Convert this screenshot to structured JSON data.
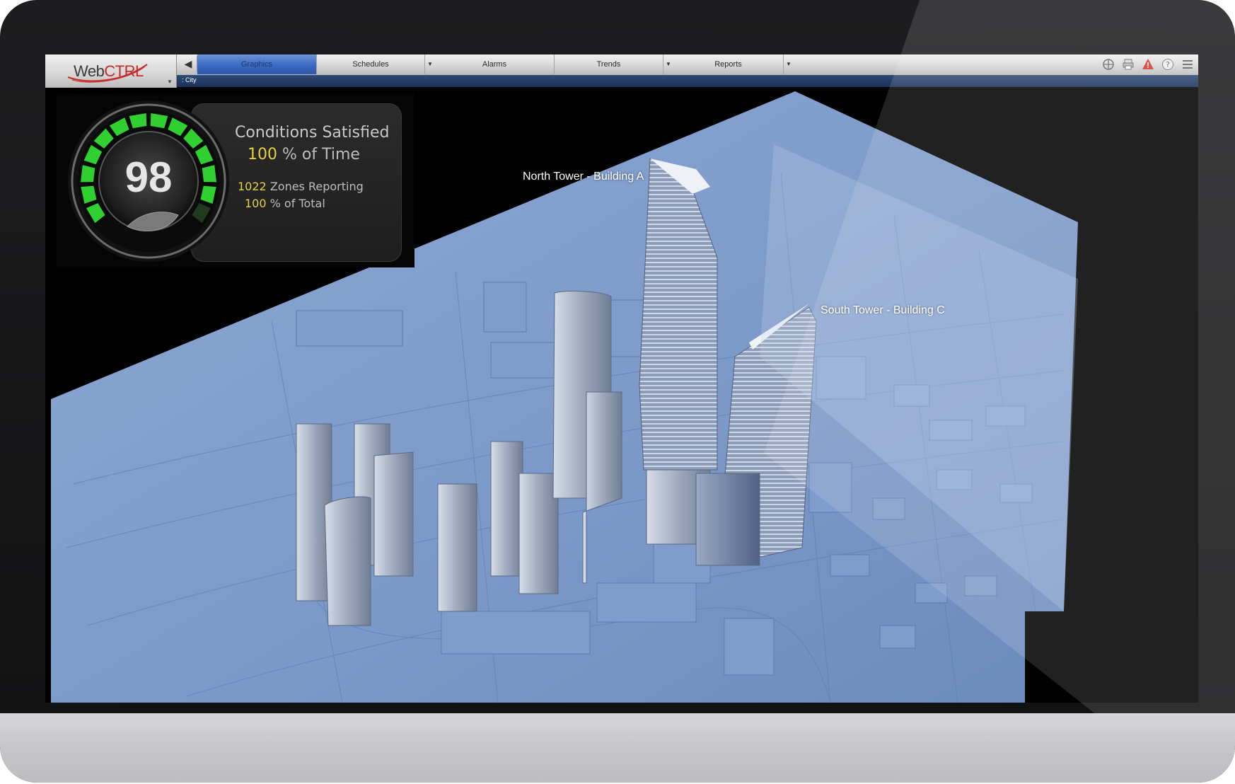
{
  "app": {
    "logo_prefix": "Web",
    "logo_accent": "CTRL",
    "brand_colors": {
      "accent_red": "#c92a2a",
      "tab_active_blue": "#3e6cc4",
      "breadcrumb_bar": "#1b3158",
      "highlight_yellow": "#e8d23c",
      "gauge_green": "#2fd02f"
    }
  },
  "nav": {
    "back_icon": "back-arrow-icon",
    "tabs": [
      {
        "label": "Graphics",
        "active": true,
        "has_dropdown": false
      },
      {
        "label": "Schedules",
        "active": false,
        "has_dropdown": true
      },
      {
        "label": "Alarms",
        "active": false,
        "has_dropdown": false
      },
      {
        "label": "Trends",
        "active": false,
        "has_dropdown": true
      },
      {
        "label": "Reports",
        "active": false,
        "has_dropdown": true
      }
    ],
    "toolbar_icons": [
      "help-nav-icon",
      "print-icon",
      "alarm-warning-icon",
      "help-icon",
      "menu-icon"
    ]
  },
  "breadcrumb": {
    "path": ": City"
  },
  "gauge": {
    "value": "98",
    "segments_total": 14,
    "segments_lit": 13,
    "conditions_title": "Conditions Satisfied",
    "time_value": "100",
    "time_label": "% of Time",
    "zones_value": "1022",
    "zones_label": "Zones Reporting",
    "total_value": "100",
    "total_label": "% of Total",
    "icon": "leaf-icon"
  },
  "scene": {
    "labels": {
      "north_tower": "North Tower - Building A",
      "south_tower": "South Tower - Building C"
    }
  }
}
